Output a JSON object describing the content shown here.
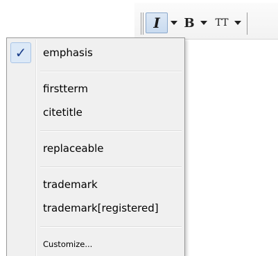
{
  "toolbar": {
    "italic_glyph": "I",
    "bold_glyph": "B",
    "teletype_glyph": "TT"
  },
  "menu": {
    "checked_mark": "✓",
    "items": [
      {
        "label": "emphasis",
        "checked": true
      },
      {
        "label": "firstterm",
        "checked": false
      },
      {
        "label": "citetitle",
        "checked": false
      },
      {
        "label": "replaceable",
        "checked": false
      },
      {
        "label": "trademark",
        "checked": false
      },
      {
        "label": "trademark[registered]",
        "checked": false
      },
      {
        "label": "Customize...",
        "checked": false
      }
    ]
  },
  "colors": {
    "active_button_bg": "#c9dbf0",
    "menu_bg": "#f0f0f0",
    "check_bg": "#dce9f7"
  }
}
